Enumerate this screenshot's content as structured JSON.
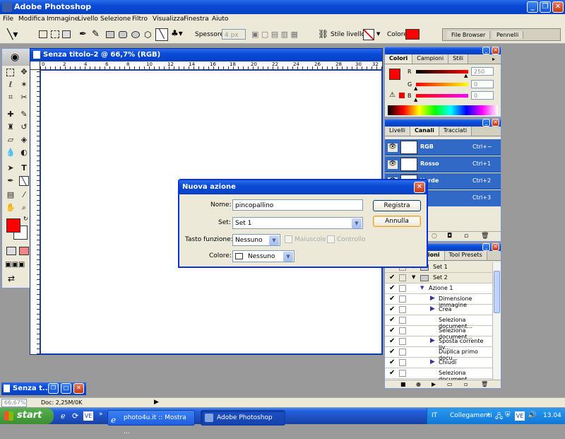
{
  "app": {
    "title": "Adobe Photoshop",
    "menu": [
      "File",
      "Modifica",
      "Immagine",
      "Livello",
      "Selezione",
      "Filtro",
      "Visualizza",
      "Finestra",
      "Aiuto"
    ]
  },
  "options": {
    "spessore_label": "Spessore:",
    "spessore_value": "4 px",
    "stile_label": "Stile livello:",
    "colore_label": "Colore:",
    "color": "#ff0000",
    "well_tabs": [
      "File Browser",
      "Pennelli"
    ]
  },
  "document": {
    "title": "Senza titolo-2 @ 66,7% (RGB)",
    "ruler_labels": [
      "0",
      "2",
      "4",
      "6",
      "8",
      "10",
      "12",
      "14",
      "16",
      "18",
      "20",
      "22",
      "24",
      "26",
      "28",
      "30",
      "32"
    ]
  },
  "colors_panel": {
    "tabs": [
      "Colori",
      "Campioni",
      "Stili"
    ],
    "channels": [
      {
        "label": "R",
        "value": "250"
      },
      {
        "label": "G",
        "value": "0"
      },
      {
        "label": "B",
        "value": "0"
      }
    ]
  },
  "channels_panel": {
    "tabs": [
      "Livelli",
      "Canali",
      "Tracciati"
    ],
    "rows": [
      {
        "name": "RGB",
        "shortcut": "Ctrl+~"
      },
      {
        "name": "Rosso",
        "shortcut": "Ctrl+1"
      },
      {
        "name": "Verde",
        "shortcut": "Ctrl+2"
      },
      {
        "name": "",
        "shortcut": "Ctrl+3"
      }
    ]
  },
  "actions_panel": {
    "tabs": [
      "Azioni",
      "Tool Presets"
    ],
    "rows": [
      {
        "label": "Set 1",
        "type": "set"
      },
      {
        "label": "Set 2",
        "type": "set"
      },
      {
        "label": "Azione 1",
        "type": "action"
      },
      {
        "label": "Dimensione immagine",
        "type": "cmd"
      },
      {
        "label": "Crea",
        "type": "cmd"
      },
      {
        "label": "Seleziona document...",
        "type": "cmd"
      },
      {
        "label": "Seleziona document...",
        "type": "cmd"
      },
      {
        "label": "Sposta corrente liv...",
        "type": "cmd"
      },
      {
        "label": "Duplica primo docu...",
        "type": "cmd"
      },
      {
        "label": "Chiudi",
        "type": "cmd"
      },
      {
        "label": "Seleziona document...",
        "type": "cmd"
      }
    ]
  },
  "dialog": {
    "title": "Nuova azione",
    "nome_label": "Nome:",
    "nome_value": "pincopallino",
    "set_label": "Set:",
    "set_value": "Set 1",
    "tasto_label": "Tasto funzione:",
    "tasto_value": "Nessuno",
    "maiuscole_label": "Maiuscole",
    "controllo_label": "Controllo",
    "colore_label": "Colore:",
    "colore_value": "Nessuno",
    "registra_label": "Registra",
    "annulla_label": "Annulla"
  },
  "minimized_doc": {
    "title": "Senza t..."
  },
  "status": {
    "zoom": "66,67%",
    "doc": "Doc: 2,25M/0K"
  },
  "taskbar": {
    "start_label": "start",
    "tasks": [
      "photo4u.it :: Mostra ...",
      "Adobe Photoshop"
    ],
    "lang": "IT",
    "tray_label": "Collegamenti",
    "clock": "13.04"
  }
}
